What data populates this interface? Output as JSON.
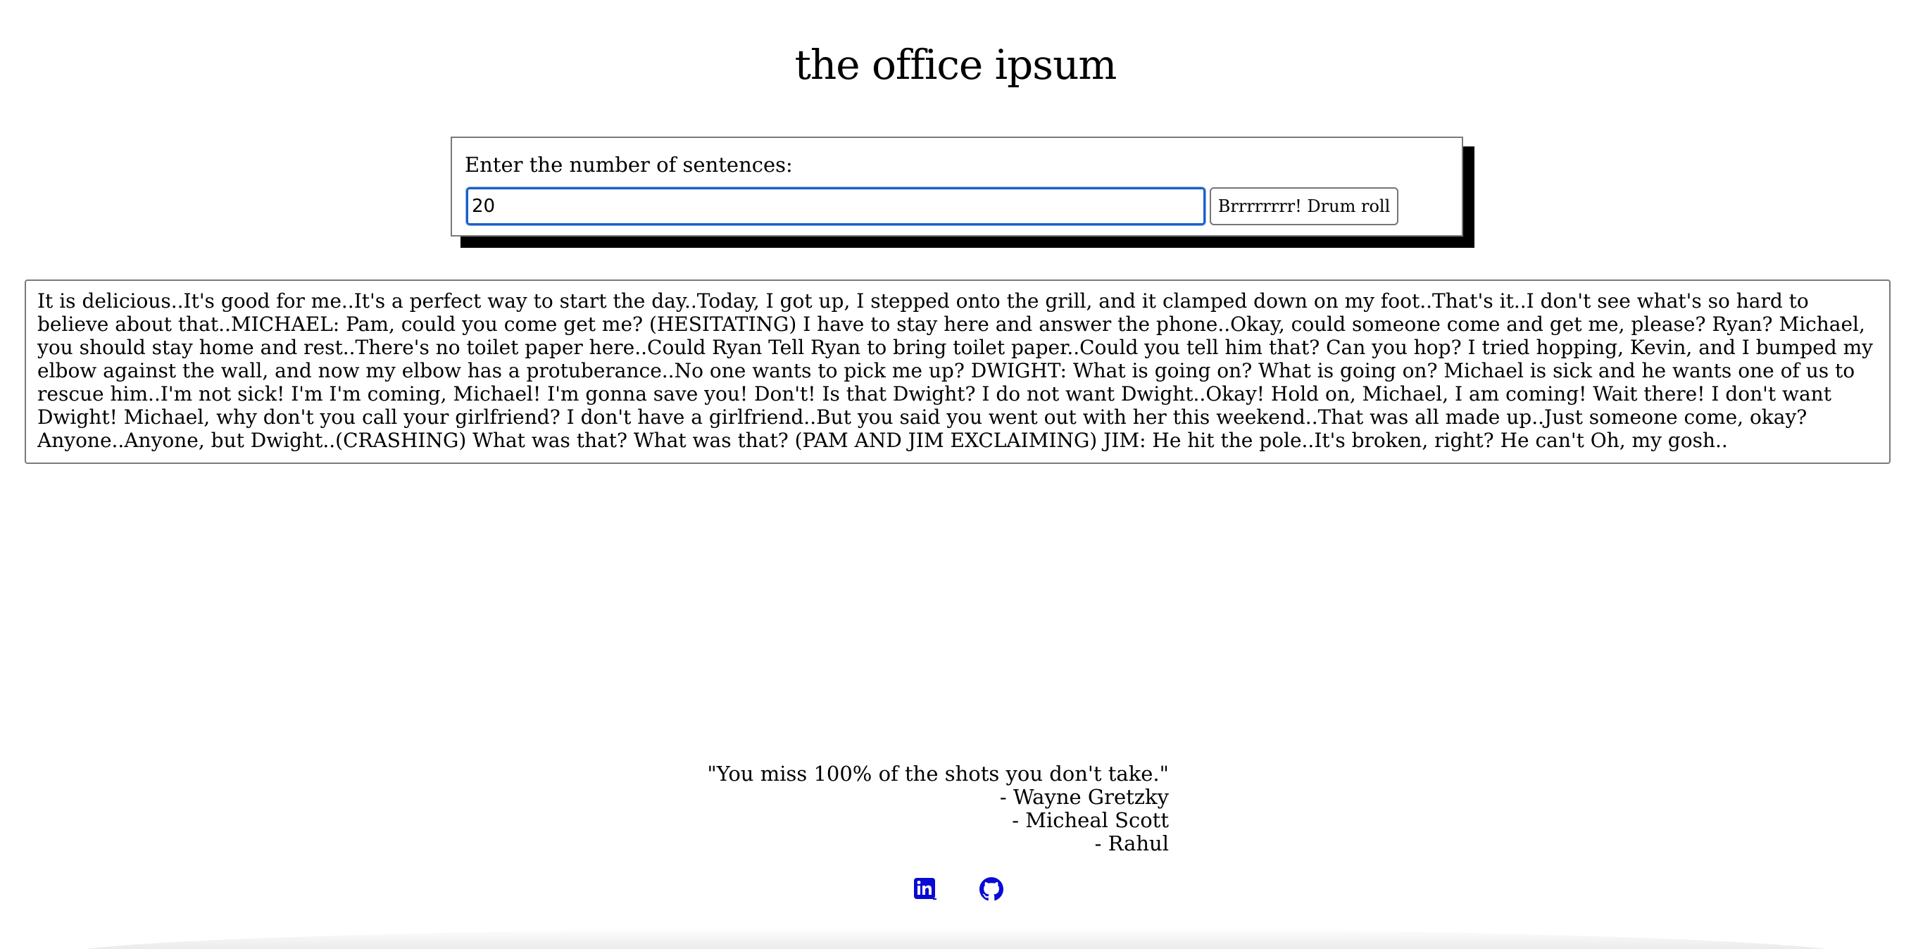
{
  "header": {
    "title": "the office ipsum"
  },
  "form": {
    "label": "Enter the number of sentences:",
    "count_value": "20",
    "submit_label": "Brrrrrrrr! Drum roll"
  },
  "output": {
    "text": "It is delicious..It's good for me..It's a perfect way to start the day..Today, I got up, I stepped onto the grill, and it clamped down on my foot..That's it..I don't see what's so hard to believe about that..MICHAEL: Pam, could you come get me? (HESITATING) I have to stay here and answer the phone..Okay, could someone come and get me, please? Ryan? Michael, you should stay home and rest..There's no toilet paper here..Could Ryan Tell Ryan to bring toilet paper..Could you tell him that? Can you hop? I tried hopping, Kevin, and I bumped my elbow against the wall, and now my elbow has a protuberance..No one wants to pick me up? DWIGHT: What is going on? What is going on? Michael is sick and he wants one of us to rescue him..I'm not sick! I'm I'm coming, Michael! I'm gonna save you! Don't! Is that Dwight? I do not want Dwight..Okay! Hold on, Michael, I am coming! Wait there! I don't want Dwight! Michael, why don't you call your girlfriend? I don't have a girlfriend..But you said you went out with her this weekend..That was all made up..Just someone come, okay? Anyone..Anyone, but Dwight..(CRASHING) What was that? What was that? (PAM AND JIM EXCLAIMING) JIM: He hit the pole..It's broken, right? He can't Oh, my gosh.."
  },
  "footer": {
    "quote": "\"You miss 100% of the shots you don't take.\"",
    "attributions": [
      "- Wayne Gretzky",
      "- Micheal Scott",
      "- Rahul"
    ],
    "links": [
      {
        "icon": "linkedin-icon",
        "color": "#0a0ad4"
      },
      {
        "icon": "github-icon",
        "color": "#0a0ad4"
      }
    ]
  }
}
